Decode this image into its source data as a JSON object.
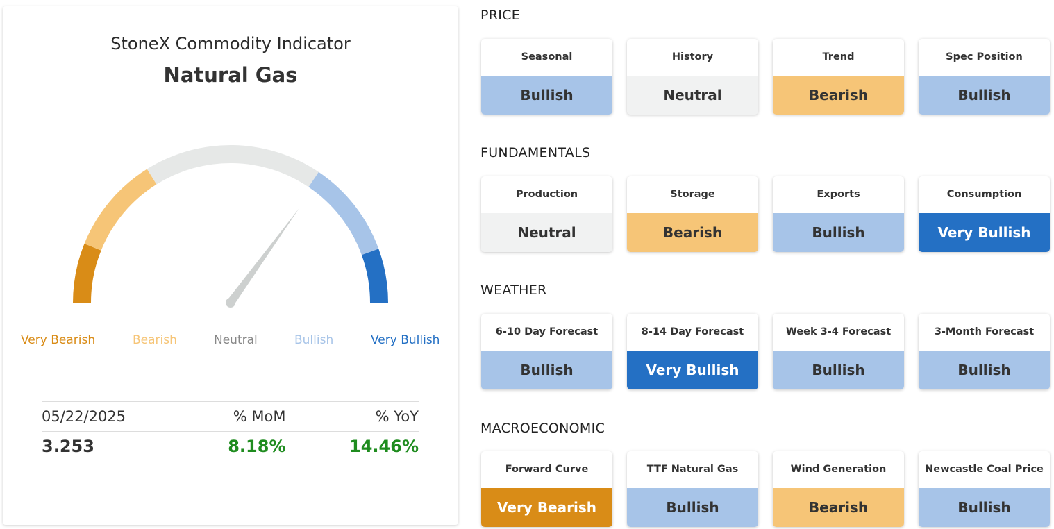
{
  "indicator": {
    "title": "StoneX Commodity Indicator",
    "commodity": "Natural Gas",
    "gauge": {
      "labels": [
        "Very Bearish",
        "Bearish",
        "Neutral",
        "Bullish",
        "Very Bullish"
      ],
      "colors": [
        "#d98c17",
        "#f6c577",
        "#e6e8e7",
        "#a7c4e8",
        "#2470c4"
      ],
      "label_colors": [
        "#d98c17",
        "#f6c577",
        "#888888",
        "#a7c4e8",
        "#2470c4"
      ],
      "needle_value": 0.7
    },
    "stats": {
      "date": "05/22/2025",
      "mom_label": "% MoM",
      "yoy_label": "% YoY",
      "price": "3.253",
      "mom": "8.18%",
      "yoy": "14.46%"
    }
  },
  "sections": [
    {
      "title": "PRICE",
      "tiles": [
        {
          "label": "Seasonal",
          "value": "Bullish",
          "cls": "c-bull"
        },
        {
          "label": "History",
          "value": "Neutral",
          "cls": "c-neut"
        },
        {
          "label": "Trend",
          "value": "Bearish",
          "cls": "c-bear"
        },
        {
          "label": "Spec Position",
          "value": "Bullish",
          "cls": "c-bull"
        }
      ]
    },
    {
      "title": "FUNDAMENTALS",
      "tiles": [
        {
          "label": "Production",
          "value": "Neutral",
          "cls": "c-neut"
        },
        {
          "label": "Storage",
          "value": "Bearish",
          "cls": "c-bear"
        },
        {
          "label": "Exports",
          "value": "Bullish",
          "cls": "c-bull"
        },
        {
          "label": "Consumption",
          "value": "Very Bullish",
          "cls": "c-vbull"
        }
      ]
    },
    {
      "title": "WEATHER",
      "tiles": [
        {
          "label": "6-10 Day Forecast",
          "value": "Bullish",
          "cls": "c-bull"
        },
        {
          "label": "8-14 Day Forecast",
          "value": "Very Bullish",
          "cls": "c-vbull"
        },
        {
          "label": "Week 3-4 Forecast",
          "value": "Bullish",
          "cls": "c-bull"
        },
        {
          "label": "3-Month Forecast",
          "value": "Bullish",
          "cls": "c-bull"
        }
      ]
    },
    {
      "title": "MACROECONOMIC",
      "tiles": [
        {
          "label": "Forward Curve",
          "value": "Very Bearish",
          "cls": "c-vbear"
        },
        {
          "label": "TTF Natural Gas",
          "value": "Bullish",
          "cls": "c-bull"
        },
        {
          "label": "Wind Generation",
          "value": "Bearish",
          "cls": "c-bear"
        },
        {
          "label": "Newcastle Coal Price",
          "value": "Bullish",
          "cls": "c-bull"
        }
      ]
    }
  ]
}
